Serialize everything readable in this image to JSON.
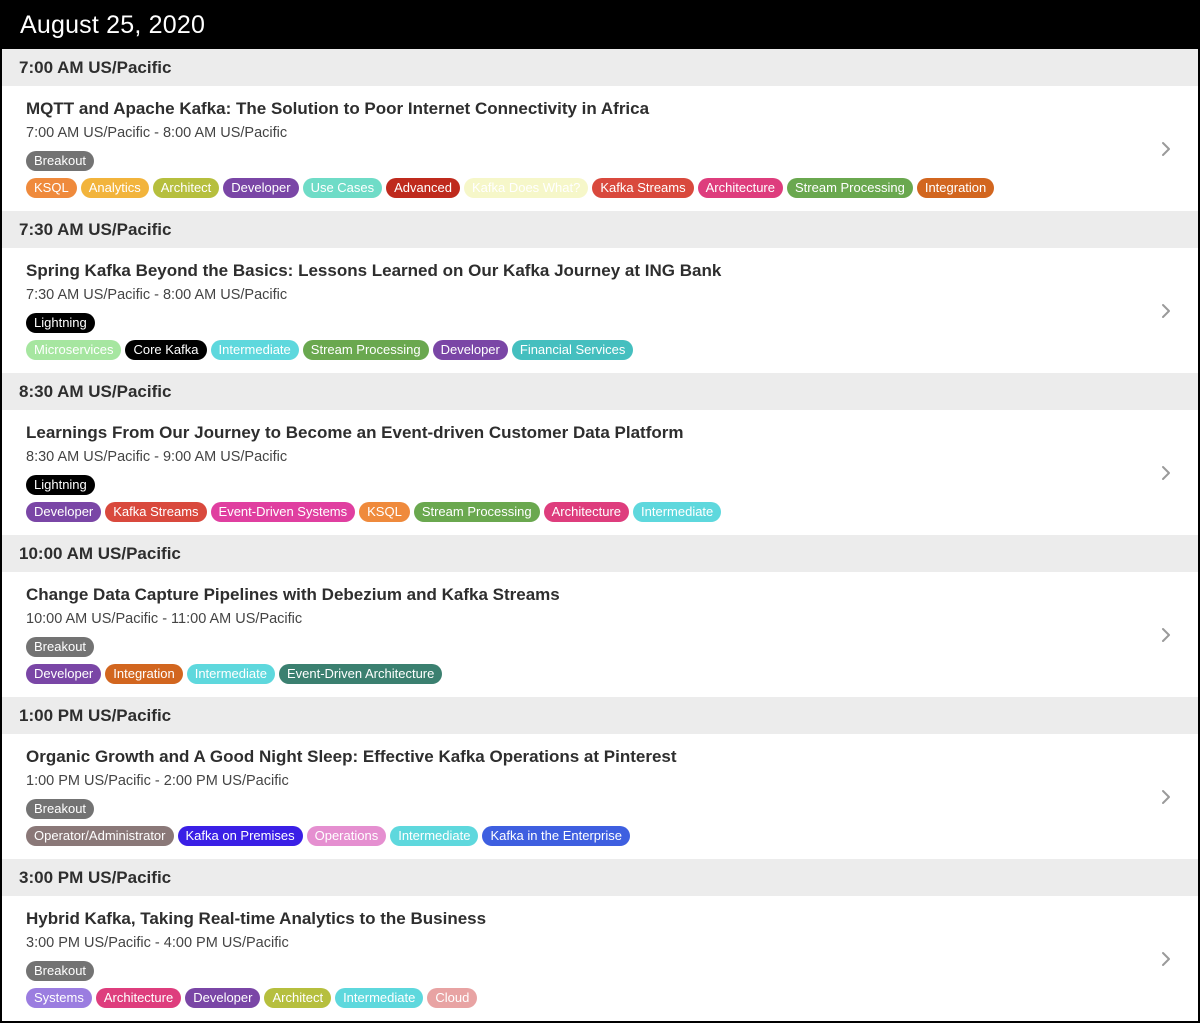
{
  "date": "August 25, 2020",
  "slots": [
    {
      "time": "7:00 AM US/Pacific",
      "session": {
        "title": "MQTT and Apache Kafka: The Solution to Poor Internet Connectivity in Africa",
        "time_range": "7:00 AM US/Pacific - 8:00 AM US/Pacific",
        "format": {
          "label": "Breakout",
          "color": "#737373"
        },
        "tags": [
          {
            "label": "KSQL",
            "color": "#ef8a3c"
          },
          {
            "label": "Analytics",
            "color": "#f2b43c"
          },
          {
            "label": "Architect",
            "color": "#b6bf3e"
          },
          {
            "label": "Developer",
            "color": "#7a46a6"
          },
          {
            "label": "Use Cases",
            "color": "#6fdcc7"
          },
          {
            "label": "Advanced",
            "color": "#bf2a1d"
          },
          {
            "label": "Kafka Does What?",
            "color": "#f6f7c9"
          },
          {
            "label": "Kafka Streams",
            "color": "#d9493d"
          },
          {
            "label": "Architecture",
            "color": "#de3d7d"
          },
          {
            "label": "Stream Processing",
            "color": "#6aa84f"
          },
          {
            "label": "Integration",
            "color": "#d2661f"
          }
        ]
      }
    },
    {
      "time": "7:30 AM US/Pacific",
      "session": {
        "title": "Spring Kafka Beyond the Basics: Lessons Learned on Our Kafka Journey at ING Bank",
        "time_range": "7:30 AM US/Pacific - 8:00 AM US/Pacific",
        "format": {
          "label": "Lightning",
          "color": "#000000"
        },
        "tags": [
          {
            "label": "Microservices",
            "color": "#a6e6a0"
          },
          {
            "label": "Core Kafka",
            "color": "#000000"
          },
          {
            "label": "Intermediate",
            "color": "#5ed8dd"
          },
          {
            "label": "Stream Processing",
            "color": "#6aa84f"
          },
          {
            "label": "Developer",
            "color": "#7a46a6"
          },
          {
            "label": "Financial Services",
            "color": "#45bfbf"
          }
        ]
      }
    },
    {
      "time": "8:30 AM US/Pacific",
      "session": {
        "title": "Learnings From Our Journey to Become an Event-driven Customer Data Platform",
        "time_range": "8:30 AM US/Pacific - 9:00 AM US/Pacific",
        "format": {
          "label": "Lightning",
          "color": "#000000"
        },
        "tags": [
          {
            "label": "Developer",
            "color": "#7a46a6"
          },
          {
            "label": "Kafka Streams",
            "color": "#d9493d"
          },
          {
            "label": "Event-Driven Systems",
            "color": "#e03fa0"
          },
          {
            "label": "KSQL",
            "color": "#ef8a3c"
          },
          {
            "label": "Stream Processing",
            "color": "#6aa84f"
          },
          {
            "label": "Architecture",
            "color": "#de3d7d"
          },
          {
            "label": "Intermediate",
            "color": "#5ed8dd"
          }
        ]
      }
    },
    {
      "time": "10:00 AM US/Pacific",
      "session": {
        "title": "Change Data Capture Pipelines with Debezium and Kafka Streams",
        "time_range": "10:00 AM US/Pacific - 11:00 AM US/Pacific",
        "format": {
          "label": "Breakout",
          "color": "#737373"
        },
        "tags": [
          {
            "label": "Developer",
            "color": "#7a46a6"
          },
          {
            "label": "Integration",
            "color": "#d2661f"
          },
          {
            "label": "Intermediate",
            "color": "#5ed8dd"
          },
          {
            "label": "Event-Driven Architecture",
            "color": "#3b8070"
          }
        ]
      }
    },
    {
      "time": "1:00 PM US/Pacific",
      "session": {
        "title": "Organic Growth and A Good Night Sleep: Effective Kafka Operations at Pinterest",
        "time_range": "1:00 PM US/Pacific - 2:00 PM US/Pacific",
        "format": {
          "label": "Breakout",
          "color": "#737373"
        },
        "tags": [
          {
            "label": "Operator/Administrator",
            "color": "#8a7878"
          },
          {
            "label": "Kafka on Premises",
            "color": "#3a1fe6"
          },
          {
            "label": "Operations",
            "color": "#e58fd0"
          },
          {
            "label": "Intermediate",
            "color": "#5ed8dd"
          },
          {
            "label": "Kafka in the Enterprise",
            "color": "#3e5fe0"
          }
        ]
      }
    },
    {
      "time": "3:00 PM US/Pacific",
      "session": {
        "title": "Hybrid Kafka, Taking Real-time Analytics to the Business",
        "time_range": "3:00 PM US/Pacific - 4:00 PM US/Pacific",
        "format": {
          "label": "Breakout",
          "color": "#737373"
        },
        "tags": [
          {
            "label": "Systems",
            "color": "#9b7de0"
          },
          {
            "label": "Architecture",
            "color": "#de3d7d"
          },
          {
            "label": "Developer",
            "color": "#7a46a6"
          },
          {
            "label": "Architect",
            "color": "#b6bf3e"
          },
          {
            "label": "Intermediate",
            "color": "#5ed8dd"
          },
          {
            "label": "Cloud",
            "color": "#e8a3a3"
          }
        ]
      }
    }
  ]
}
